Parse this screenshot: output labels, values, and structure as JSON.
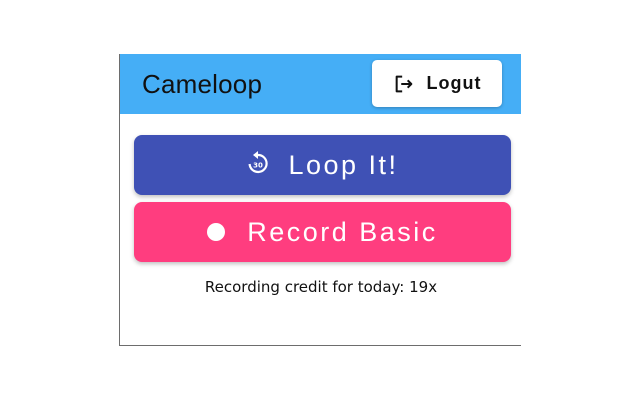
{
  "header": {
    "title": "Cameloop",
    "logout_label": "Logut",
    "background": "#45aef6"
  },
  "actions": {
    "loop_label": "Loop It!",
    "loop_icon": "replay-30-icon",
    "loop_color": "#3f51b5",
    "record_label": "Record Basic",
    "record_icon": "record-dot-icon",
    "record_color": "#ff3d7f"
  },
  "footer": {
    "credit_text": "Recording credit for today: 19x"
  }
}
